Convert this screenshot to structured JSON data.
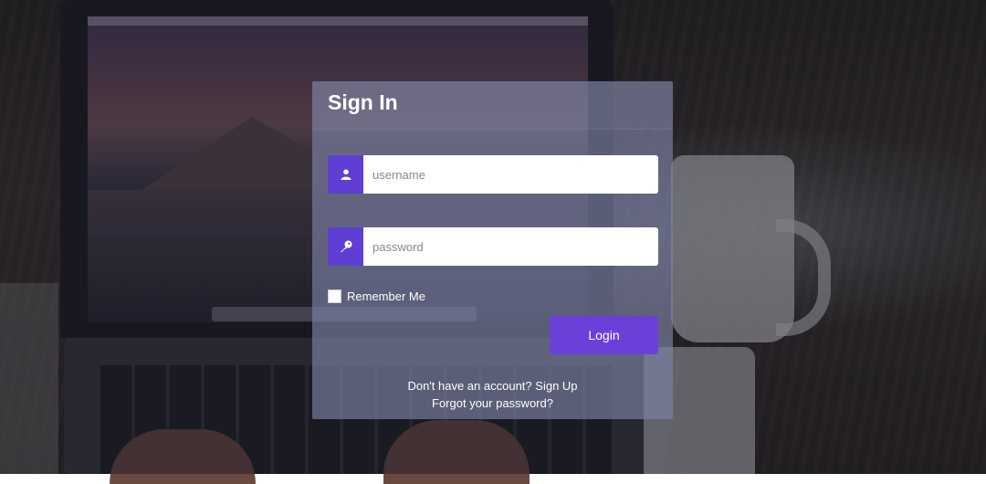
{
  "form": {
    "title": "Sign In",
    "username_placeholder": "username",
    "password_placeholder": "password",
    "remember_label": "Remember Me",
    "login_label": "Login",
    "no_account_text": "Don't have an account?",
    "signup_label": "Sign Up",
    "forgot_label": "Forgot your password?"
  },
  "icons": {
    "username": "user-icon",
    "password": "key-icon"
  },
  "colors": {
    "accent": "#6a40d9",
    "addon": "#5e3ed3"
  }
}
